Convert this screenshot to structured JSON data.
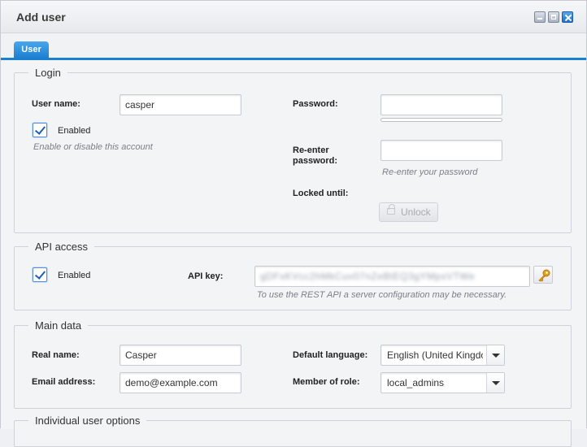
{
  "window": {
    "title": "Add user"
  },
  "tabs": [
    {
      "label": "User"
    }
  ],
  "login": {
    "legend": "Login",
    "username_label": "User name:",
    "username_value": "casper",
    "enabled_label": "Enabled",
    "enabled_hint": "Enable or disable this account",
    "password_label": "Password:",
    "password_value": "",
    "reenter_label_line1": "Re-enter",
    "reenter_label_line2": "password:",
    "reenter_value": "",
    "reenter_hint": "Re-enter your password",
    "locked_until_label": "Locked until:",
    "unlock_label": "Unlock"
  },
  "api": {
    "legend": "API access",
    "enabled_label": "Enabled",
    "api_key_label": "API key:",
    "api_key_value": "gDFxKVcc2hMkCuv07nZeBtEQ3gYMpxVTWe",
    "hint": "To use the REST API a server configuration may be necessary."
  },
  "main": {
    "legend": "Main data",
    "real_name_label": "Real name:",
    "real_name_value": "Casper",
    "email_label": "Email address:",
    "email_value": "demo@example.com",
    "language_label": "Default language:",
    "language_value": "English (United Kingdom)",
    "role_label": "Member of role:",
    "role_value": "local_admins"
  },
  "individual": {
    "legend": "Individual user options"
  },
  "colors": {
    "accent": "#1d7fd0",
    "key_icon": "#e2a11c"
  }
}
